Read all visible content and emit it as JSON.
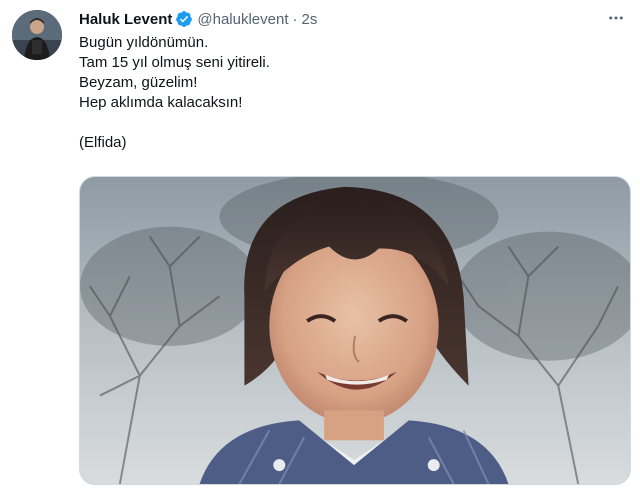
{
  "author": {
    "display_name": "Haluk Levent",
    "handle": "@haluklevent",
    "separator": "·",
    "time": "2s",
    "avatar_icon": "user-avatar",
    "verified_icon": "verified-badge-icon",
    "verified_color": "#1d9bf0"
  },
  "more_icon": "more-dots-icon",
  "tweet": {
    "lines": [
      "Bugün yıldönümün.",
      "Tam 15 yıl olmuş seni yitireli.",
      "Beyzam, güzelim!",
      "Hep aklımda kalacaksın!",
      "(Elfida)"
    ]
  },
  "media": {
    "type": "photo"
  }
}
